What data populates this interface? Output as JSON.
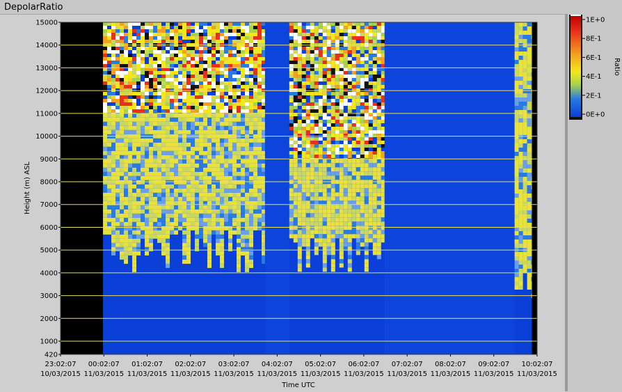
{
  "window_title": "DepolarRatio",
  "chart_data": {
    "type": "heatmap",
    "title": "DepolarRatio",
    "xlabel": "Time UTC",
    "ylabel": "Height (m) ASL",
    "colorbar_label": "Ratio",
    "ylim": [
      420,
      15000
    ],
    "xlim_hours": [
      0,
      11
    ],
    "y_ticks": [
      420,
      1000,
      2000,
      3000,
      4000,
      5000,
      6000,
      7000,
      8000,
      9000,
      10000,
      11000,
      12000,
      13000,
      14000,
      15000
    ],
    "x_ticks": [
      {
        "time": "23:02:07",
        "date": "10/03/2015"
      },
      {
        "time": "00:02:07",
        "date": "11/03/2015"
      },
      {
        "time": "01:02:07",
        "date": "11/03/2015"
      },
      {
        "time": "02:02:07",
        "date": "11/03/2015"
      },
      {
        "time": "03:02:07",
        "date": "11/03/2015"
      },
      {
        "time": "04:02:07",
        "date": "11/03/2015"
      },
      {
        "time": "05:02:07",
        "date": "11/03/2015"
      },
      {
        "time": "06:02:07",
        "date": "11/03/2015"
      },
      {
        "time": "07:02:07",
        "date": "11/03/2015"
      },
      {
        "time": "08:02:07",
        "date": "11/03/2015"
      },
      {
        "time": "09:02:07",
        "date": "11/03/2015"
      },
      {
        "time": "10:02:07",
        "date": "11/03/2015"
      }
    ],
    "colorbar_ticks": [
      "1E+0",
      "8E-1",
      "6E-1",
      "4E-1",
      "2E-1",
      "0E+0"
    ],
    "colorscale": [
      "#0a3fd8",
      "#2a7be0",
      "#a8d24a",
      "#f2e81c",
      "#f5a020",
      "#e8301a",
      "#c00000"
    ],
    "nodata_color": "#000000",
    "grid": true,
    "grid_color": "#e8e060",
    "segments": [
      {
        "kind": "nodata",
        "start_hour": 0.0,
        "end_hour": 0.98
      },
      {
        "kind": "noisy",
        "start_hour": 0.98,
        "end_hour": 4.72,
        "cloud_top_m": 11000,
        "signal_base_m": 4200
      },
      {
        "kind": "low",
        "start_hour": 4.72,
        "end_hour": 5.28
      },
      {
        "kind": "noisy",
        "start_hour": 5.28,
        "end_hour": 7.48,
        "cloud_top_m": 9000,
        "signal_base_m": 4000
      },
      {
        "kind": "low",
        "start_hour": 7.48,
        "end_hour": 10.48
      },
      {
        "kind": "noisy",
        "start_hour": 10.48,
        "end_hour": 10.88,
        "cloud_top_m": 15000,
        "signal_base_m": 3000
      },
      {
        "kind": "nodata",
        "start_hour": 10.88,
        "end_hour": 11.0
      }
    ]
  }
}
